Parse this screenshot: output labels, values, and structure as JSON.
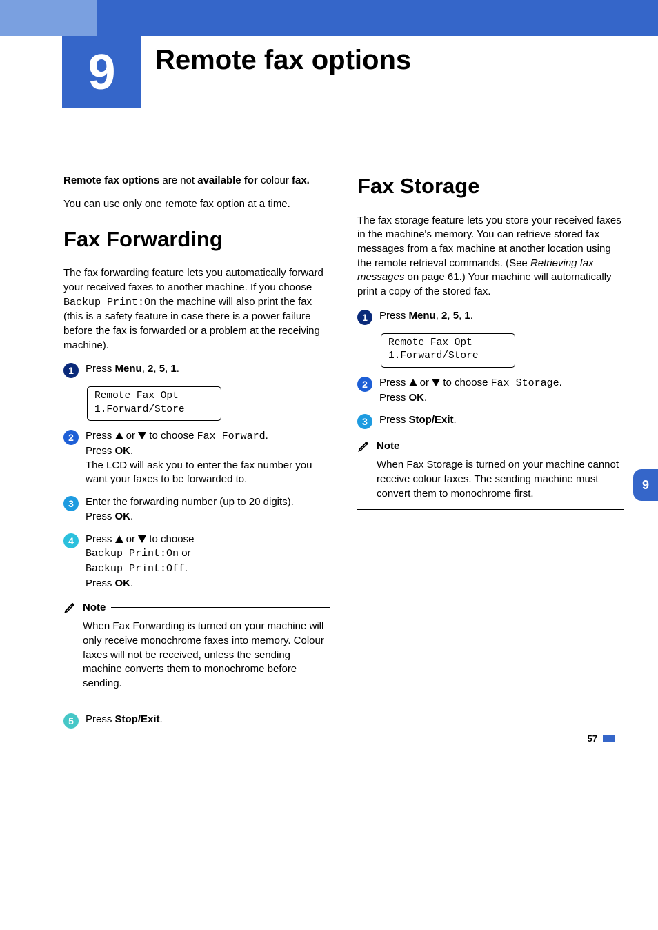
{
  "chapter": {
    "number": "9",
    "title": "Remote fax options",
    "side_tab": "9"
  },
  "intro": {
    "p1_b1": "Remote fax options",
    "p1_mid": " are not ",
    "p1_b2": "available for",
    "p1_tail_pre": "colour ",
    "p1_tail_b": "fax.",
    "p2": "You can use only one remote fax option at a time."
  },
  "fax_forward": {
    "heading": "Fax Forwarding",
    "intro_pre": "The fax forwarding feature lets you automatically forward your received faxes to another machine. If you choose ",
    "intro_mono": "Backup Print:On",
    "intro_post": " the machine will also print the fax (this is a safety feature in case there is a power failure before the fax is forwarded or a problem at the receiving machine).",
    "steps": [
      {
        "num": "1",
        "pre": "Press ",
        "b1": "Menu",
        "mid": ", ",
        "b2": "2",
        "mid2": ", ",
        "b3": "5",
        "mid3": ", ",
        "b4": "1",
        "post": ".",
        "lcd": "Remote Fax Opt\n1.Forward/Store"
      },
      {
        "num": "2",
        "pre": "Press ",
        "mid": " or ",
        "post_pre": " to choose ",
        "mono": "Fax Forward",
        "post": ".",
        "line2_pre": "Press ",
        "line2_b": "OK",
        "line2_post": ".",
        "line3": "The LCD will ask you to enter the fax number you want your faxes to be forwarded to."
      },
      {
        "num": "3",
        "line1": "Enter the forwarding number (up to 20 digits).",
        "line2_pre": "Press ",
        "line2_b": "OK",
        "line2_post": "."
      },
      {
        "num": "4",
        "pre": "Press ",
        "mid": " or ",
        "post_pre": " to choose",
        "mono1": "Backup Print:On",
        "or": " or",
        "mono2": "Backup Print:Off",
        "dot": ".",
        "line2_pre": "Press ",
        "line2_b": "OK",
        "line2_post": "."
      },
      {
        "num": "5",
        "pre": "Press ",
        "b1": "Stop/Exit",
        "post": "."
      }
    ],
    "note_label": "Note",
    "note_body": "When Fax Forwarding is turned on your machine will only receive monochrome faxes into memory. Colour faxes will not be received, unless the sending machine converts them to monochrome before sending."
  },
  "fax_storage": {
    "heading": "Fax Storage",
    "intro_pre": "The fax storage feature lets you store your received faxes in the machine's memory. You can retrieve stored fax messages from a fax machine at another location using the remote retrieval commands. (See ",
    "intro_link": "Retrieving fax messages",
    "intro_post": " on page 61.) Your machine will automatically print a copy of the stored fax.",
    "steps": [
      {
        "num": "1",
        "pre": "Press ",
        "b1": "Menu",
        "mid": ", ",
        "b2": "2",
        "mid2": ", ",
        "b3": "5",
        "mid3": ", ",
        "b4": "1",
        "post": ".",
        "lcd": "Remote Fax Opt\n1.Forward/Store"
      },
      {
        "num": "2",
        "pre": "Press ",
        "mid": " or ",
        "post_pre": " to choose ",
        "mono": "Fax Storage",
        "post": ".",
        "line2_pre": "Press ",
        "line2_b": "OK",
        "line2_post": "."
      },
      {
        "num": "3",
        "pre": "Press ",
        "b1": "Stop/Exit",
        "post": "."
      }
    ],
    "note_label": "Note",
    "note_body": "When Fax Storage is turned on your machine cannot receive colour faxes. The sending machine must convert them to monochrome first."
  },
  "page_number": "57"
}
